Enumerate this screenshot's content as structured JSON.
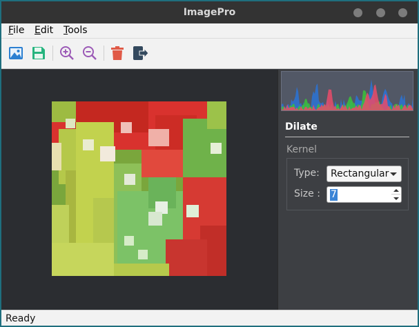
{
  "window": {
    "title": "ImagePro"
  },
  "menu": [
    {
      "label": "File",
      "accel": "F",
      "rest": "ile"
    },
    {
      "label": "Edit",
      "accel": "E",
      "rest": "dit"
    },
    {
      "label": "Tools",
      "accel": "T",
      "rest": "ools"
    }
  ],
  "toolbar": {
    "icons": [
      "open-image-icon",
      "save-icon",
      "zoom-in-icon",
      "zoom-out-icon",
      "delete-icon",
      "exit-icon"
    ]
  },
  "panel": {
    "title": "Dilate",
    "group_label": "Kernel",
    "type_label": "Type:",
    "type_value": "Rectangular",
    "size_label": "Size :",
    "size_value": "7"
  },
  "status": {
    "text": "Ready"
  },
  "colors": {
    "accent_border": "#1f6f7e",
    "histogram_bg": "#525866",
    "hist_blue": "#2a73d6",
    "hist_red": "#e94b6a",
    "hist_green": "#39c23a"
  }
}
